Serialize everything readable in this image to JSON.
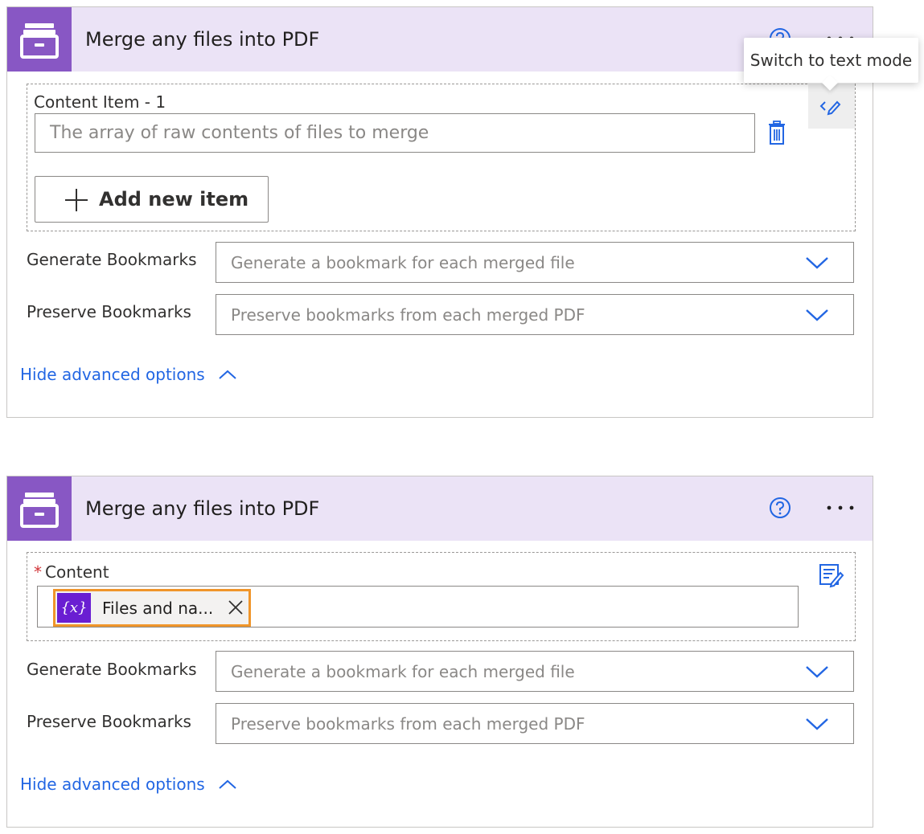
{
  "card1": {
    "title": "Merge any files into PDF",
    "content_item_label": "Content Item - 1",
    "content_item_placeholder": "The array of raw contents of files to merge",
    "add_new_item_label": "Add new item",
    "generate_bookmarks_label": "Generate Bookmarks",
    "generate_bookmarks_placeholder": "Generate a bookmark for each merged file",
    "preserve_bookmarks_label": "Preserve Bookmarks",
    "preserve_bookmarks_placeholder": "Preserve bookmarks from each merged PDF",
    "hide_advanced_label": "Hide advanced options",
    "tooltip": "Switch to text mode"
  },
  "card2": {
    "title": "Merge any files into PDF",
    "required_marker": "*",
    "content_label": "Content",
    "token_symbol": "{x}",
    "token_label": "Files and na...",
    "generate_bookmarks_label": "Generate Bookmarks",
    "generate_bookmarks_placeholder": "Generate a bookmark for each merged file",
    "preserve_bookmarks_label": "Preserve Bookmarks",
    "preserve_bookmarks_placeholder": "Preserve bookmarks from each merged PDF",
    "hide_advanced_label": "Hide advanced options"
  },
  "colors": {
    "header_bg": "#ebe3f6",
    "app_icon_bg": "#8857c4",
    "link_blue": "#2266e3",
    "token_border": "#f0952a",
    "token_var_bg": "#6a1ed2",
    "required_red": "#d13438"
  },
  "icons": [
    "file-cabinet-icon",
    "help-icon",
    "more-icon",
    "text-mode-icon",
    "trash-icon",
    "plus-icon",
    "chevron-down-icon",
    "chevron-up-icon",
    "variable-icon",
    "close-icon",
    "edit-form-icon"
  ]
}
